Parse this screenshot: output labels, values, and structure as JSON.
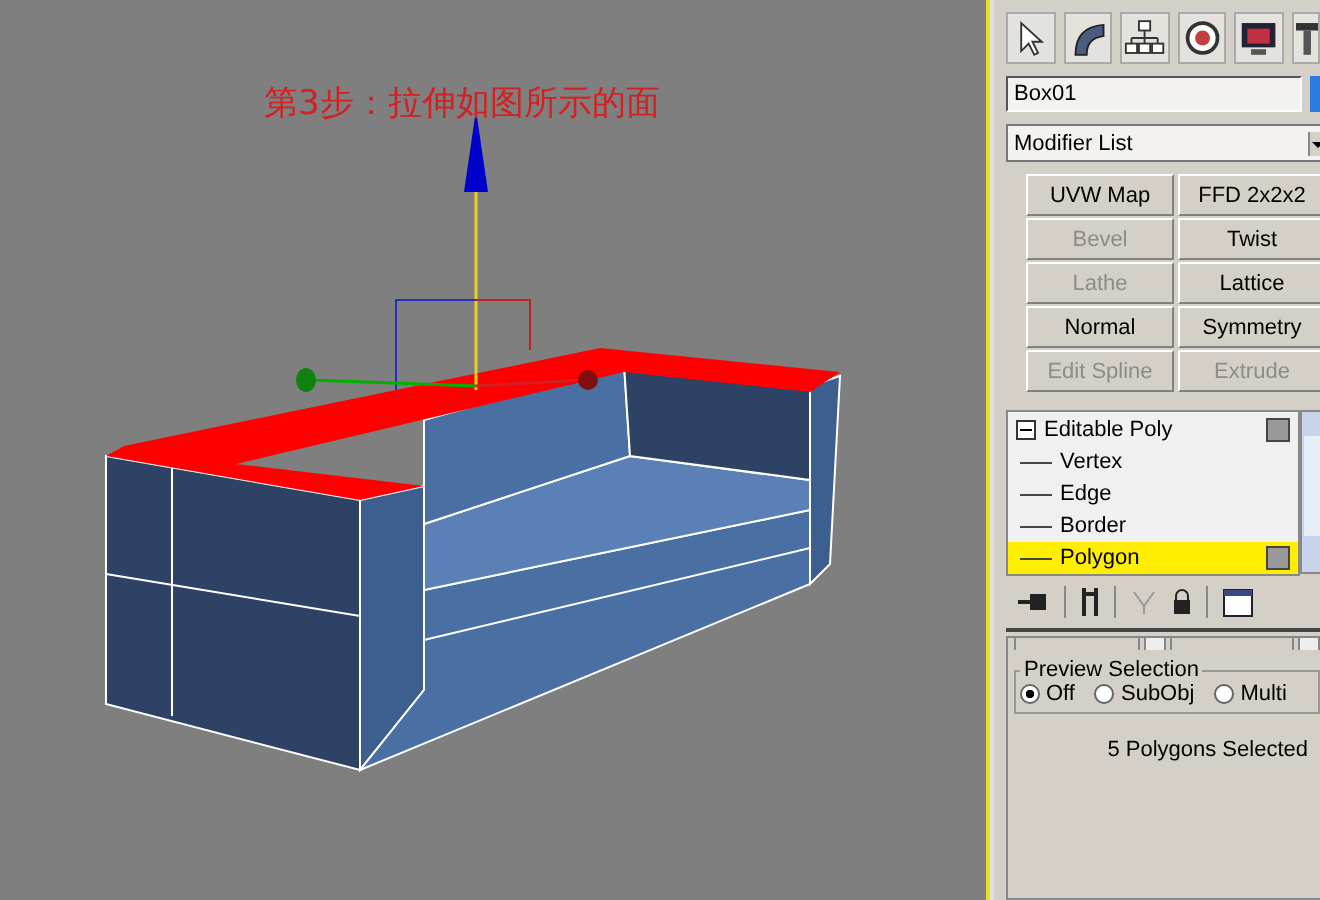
{
  "viewport": {
    "caption": "第3步：拉伸如图所示的面"
  },
  "command_panel": {
    "object_name": "Box01",
    "modifier_list": "Modifier List",
    "modifier_buttons": [
      {
        "label": "UVW Map",
        "disabled": false
      },
      {
        "label": "FFD 2x2x2",
        "disabled": false
      },
      {
        "label": "Bevel",
        "disabled": true
      },
      {
        "label": "Twist",
        "disabled": false
      },
      {
        "label": "Lathe",
        "disabled": true
      },
      {
        "label": "Lattice",
        "disabled": false
      },
      {
        "label": "Normal",
        "disabled": false
      },
      {
        "label": "Symmetry",
        "disabled": false
      },
      {
        "label": "Edit Spline",
        "disabled": true
      },
      {
        "label": "Extrude",
        "disabled": true
      }
    ],
    "modifier_stack": [
      {
        "label": "Editable Poly",
        "expanded": true,
        "selected": false,
        "children": [
          {
            "label": "Vertex",
            "selected": false
          },
          {
            "label": "Edge",
            "selected": false
          },
          {
            "label": "Border",
            "selected": false
          },
          {
            "label": "Polygon",
            "selected": true
          }
        ]
      }
    ],
    "preview_selection": {
      "title": "Preview Selection",
      "options": [
        {
          "label": "Off",
          "selected": true
        },
        {
          "label": "SubObj",
          "selected": false
        },
        {
          "label": "Multi",
          "selected": false
        }
      ]
    },
    "status": "5 Polygons Selected"
  }
}
